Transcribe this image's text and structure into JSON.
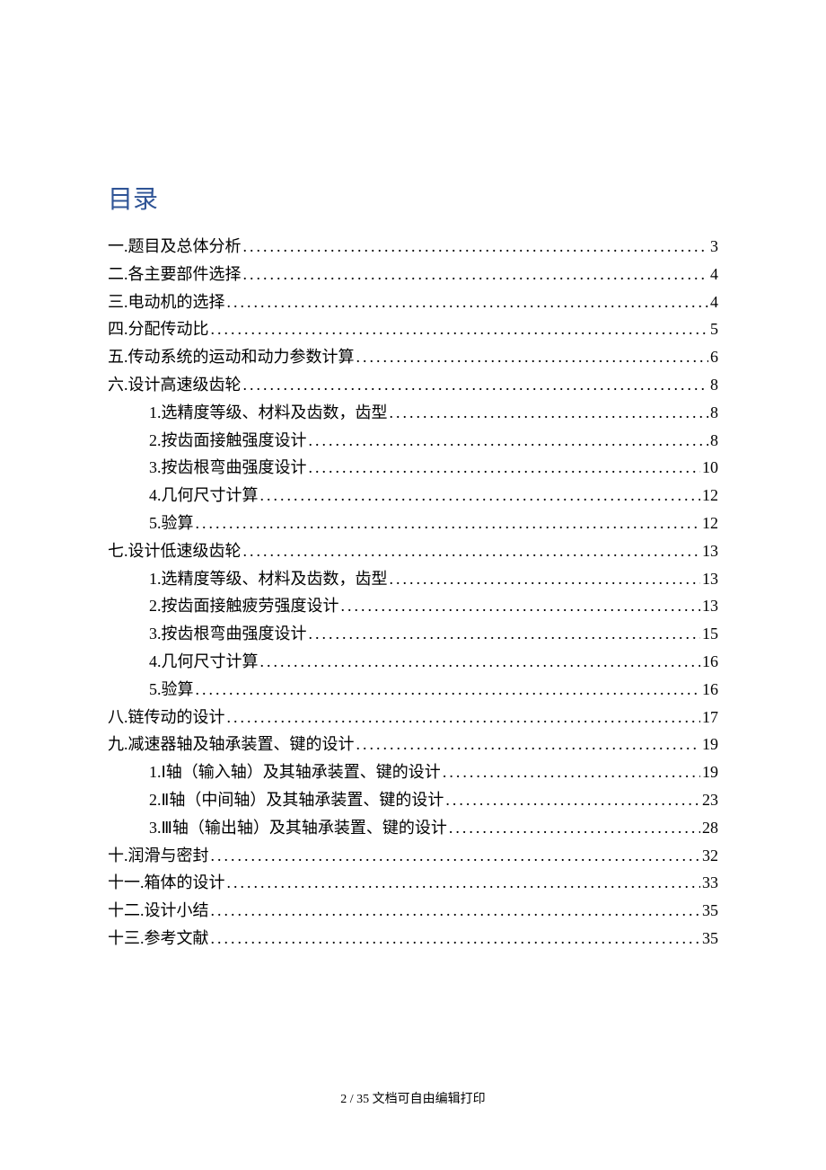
{
  "title": "目录",
  "entries": [
    {
      "label": "一.题目及总体分析 ",
      "page": "3",
      "sub": false
    },
    {
      "label": "二.各主要部件选择 ",
      "page": "4",
      "sub": false
    },
    {
      "label": "三.电动机的选择 ",
      "page": "4",
      "sub": false
    },
    {
      "label": "四.分配传动比 ",
      "page": "5",
      "sub": false
    },
    {
      "label": "五.传动系统的运动和动力参数计算 ",
      "page": "6",
      "sub": false
    },
    {
      "label": "六.设计高速级齿轮 ",
      "page": "8",
      "sub": false
    },
    {
      "label": "1.选精度等级、材料及齿数，齿型",
      "page": "8",
      "sub": true
    },
    {
      "label": "2.按齿面接触强度设计",
      "page": "8",
      "sub": true
    },
    {
      "label": "3.按齿根弯曲强度设计",
      "page": "10",
      "sub": true
    },
    {
      "label": "4.几何尺寸计算",
      "page": "12",
      "sub": true
    },
    {
      "label": "5.验算",
      "page": "12",
      "sub": true
    },
    {
      "label": "七.设计低速级齿轮 ",
      "page": "13",
      "sub": false
    },
    {
      "label": "1.选精度等级、材料及齿数，齿型",
      "page": "13",
      "sub": true
    },
    {
      "label": "2.按齿面接触疲劳强度设计",
      "page": "13",
      "sub": true
    },
    {
      "label": "3.按齿根弯曲强度设计",
      "page": "15",
      "sub": true
    },
    {
      "label": "4.几何尺寸计算",
      "page": "16",
      "sub": true
    },
    {
      "label": "5.验算",
      "page": "16",
      "sub": true
    },
    {
      "label": "八.链传动的设计 ",
      "page": "17",
      "sub": false
    },
    {
      "label": "九.减速器轴及轴承装置、键的设计 ",
      "page": "19",
      "sub": false
    },
    {
      "label": "1.Ⅰ轴（输入轴）及其轴承装置、键的设计",
      "page": "19",
      "sub": true
    },
    {
      "label": "2.Ⅱ轴（中间轴）及其轴承装置、键的设计",
      "page": "23",
      "sub": true
    },
    {
      "label": "3.Ⅲ轴（输出轴）及其轴承装置、键的设计",
      "page": "28",
      "sub": true
    },
    {
      "label": "十.润滑与密封 ",
      "page": "32",
      "sub": false
    },
    {
      "label": "十一.箱体的设计 ",
      "page": "33",
      "sub": false
    },
    {
      "label": "十二.设计小结 ",
      "page": "35",
      "sub": false
    },
    {
      "label": "十三.参考文献 ",
      "page": "35",
      "sub": false
    }
  ],
  "footer": "2 / 35 文档可自由编辑打印"
}
